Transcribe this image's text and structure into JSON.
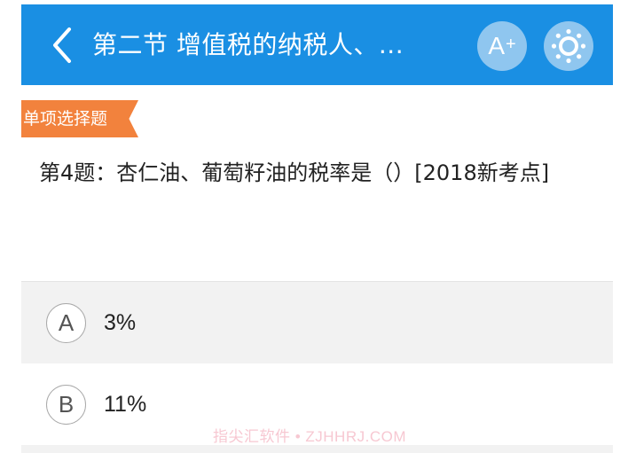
{
  "header": {
    "title": "第二节 增值税的纳税人、...",
    "font_size_button": {
      "letter": "A",
      "sup": "+"
    },
    "back_icon": "chevron-left-icon",
    "settings_icon": "gear-icon",
    "color": "#1a8fe3"
  },
  "question": {
    "type_tag": "单项选择题",
    "text": "第4题：杏仁油、葡萄籽油的税率是（）[2018新考点]",
    "tag_color": "#f2823d"
  },
  "options": [
    {
      "letter": "A",
      "text": "3%"
    },
    {
      "letter": "B",
      "text": "11%"
    }
  ],
  "watermark": "指尖汇软件 • ZJHHRJ.COM"
}
